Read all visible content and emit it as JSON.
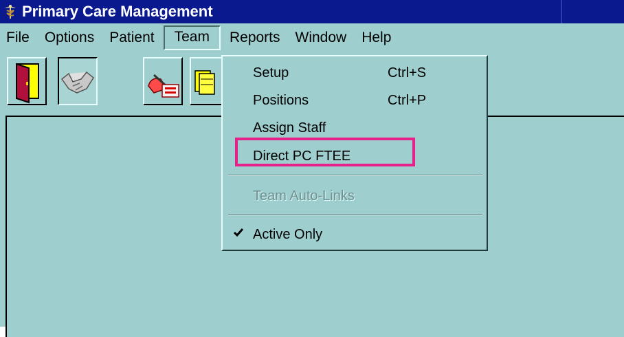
{
  "window": {
    "title": "Primary Care Management",
    "icon": "caduceus-icon"
  },
  "menubar": {
    "items": [
      "File",
      "Options",
      "Patient",
      "Team",
      "Reports",
      "Window",
      "Help"
    ],
    "open_item": "Team"
  },
  "toolbar": {
    "buttons": [
      {
        "icon": "exit-door-icon"
      },
      {
        "icon": "handshake-icon",
        "pressed": true
      },
      {
        "icon": "patient-assign-icon"
      },
      {
        "icon": "folders-icon"
      }
    ]
  },
  "team_menu": {
    "items": [
      {
        "label": "Setup",
        "shortcut": "Ctrl+S",
        "enabled": true
      },
      {
        "label": "Positions",
        "shortcut": "Ctrl+P",
        "enabled": true
      },
      {
        "label": "Assign Staff",
        "shortcut": "",
        "enabled": true
      },
      {
        "label": "Direct PC FTEE",
        "shortcut": "",
        "enabled": true,
        "highlighted": true
      },
      {
        "label": "Team Auto-Links",
        "shortcut": "",
        "enabled": false
      },
      {
        "label": "Active Only",
        "shortcut": "",
        "enabled": true,
        "checked": true
      }
    ]
  },
  "colors": {
    "titlebar": "#0a1a8e",
    "background": "#9ecece",
    "highlight_box": "#e8218a"
  }
}
